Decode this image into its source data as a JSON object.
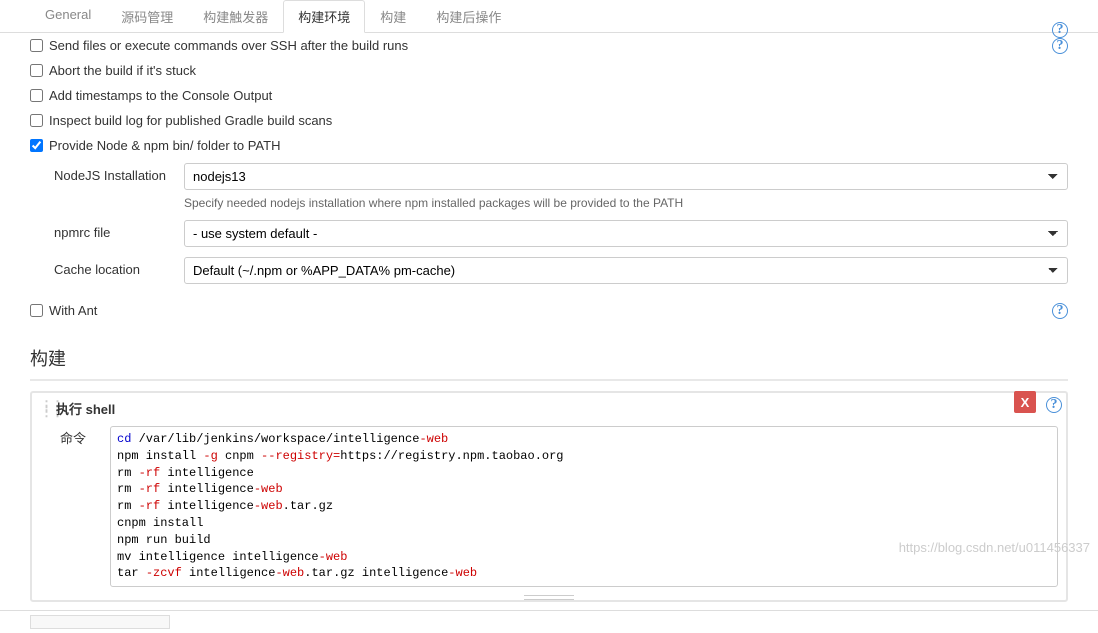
{
  "tabs": {
    "general": "General",
    "scm": "源码管理",
    "triggers": "构建触发器",
    "env": "构建环境",
    "build": "构建",
    "post": "构建后操作"
  },
  "envOptions": {
    "sshAfter": "Send files or execute commands over SSH after the build runs",
    "abort": "Abort the build if it's stuck",
    "timestamps": "Add timestamps to the Console Output",
    "gradle": "Inspect build log for published Gradle build scans",
    "nodepath": "Provide Node & npm bin/ folder to PATH",
    "withAnt": "With Ant"
  },
  "nodejs": {
    "installLabel": "NodeJS Installation",
    "installValue": "nodejs13",
    "installHelp": "Specify needed nodejs installation where npm installed packages will be provided to the PATH",
    "npmrcLabel": "npmrc file",
    "npmrcValue": "- use system default -",
    "cacheLabel": "Cache location",
    "cacheValue": "Default (~/.npm or %APP_DATA% pm-cache)"
  },
  "build": {
    "header": "构建",
    "shellTitle": "执行 shell",
    "cmdLabel": "命令"
  },
  "script": {
    "l1a": "cd",
    "l1b": " /var/lib/jenkins/workspace/intelligence",
    "l1c": "-web",
    "l2a": "npm install ",
    "l2b": "-g",
    "l2c": " cnpm ",
    "l2d": "--registry=",
    "l2e": "https://registry.npm.taobao.org",
    "l3a": "rm ",
    "l3b": "-rf",
    "l3c": " intelligence",
    "l4a": "rm ",
    "l4b": "-rf",
    "l4c": " intelligence",
    "l4d": "-web",
    "l5a": "rm ",
    "l5b": "-rf",
    "l5c": " intelligence",
    "l5d": "-web",
    "l5e": ".tar.gz",
    "l6": "cnpm install",
    "l7": "npm run build",
    "l8a": "mv intelligence intelligence",
    "l8b": "-web",
    "l9a": "tar ",
    "l9b": "-zcvf",
    "l9c": " intelligence",
    "l9d": "-web",
    "l9e": ".tar.gz intelligence",
    "l9f": "-web"
  },
  "watermark": "https://blog.csdn.net/u011456337"
}
